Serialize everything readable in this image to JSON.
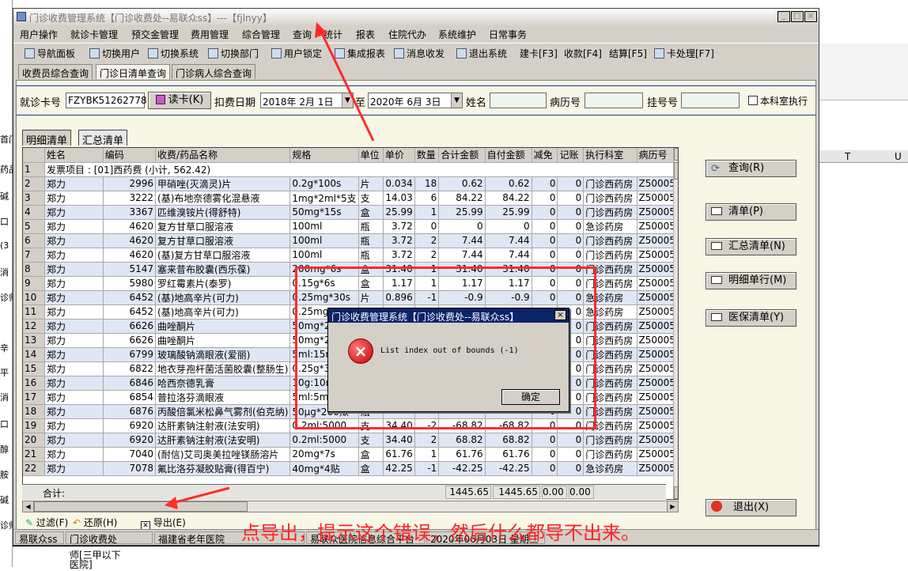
{
  "window": {
    "title": "门诊收费管理系统【门诊收费处--易联众ss】---【fjlnyy】",
    "controls": [
      "_",
      "□",
      "×"
    ]
  },
  "menu": [
    "用户操作",
    "就诊卡管理",
    "预交金管理",
    "费用管理",
    "综合管理",
    "查询",
    "统计",
    "报表",
    "住院代办",
    "系统维护",
    "日常事务"
  ],
  "toolbar": [
    "导航面板",
    "切换用户",
    "切换系统",
    "切换部门",
    "用户锁定",
    "集成报表",
    "消息收发",
    "退出系统",
    "建卡[F3]",
    "收款[F4]",
    "结算[F5]",
    "卡处理[F7]"
  ],
  "tabs": [
    "收费员综合查询",
    "门诊日清单查询",
    "门诊病人综合查询"
  ],
  "search": {
    "card_label": "就诊卡号",
    "card_value": "FZYBK51262778",
    "read_button": "读卡(K)",
    "date_label": "扣费日期",
    "date_from": "2018年 2月 1日",
    "to_label": "至",
    "date_to": "2020年 6月 3日",
    "name_label": "姓名",
    "record_label": "病历号",
    "reg_label": "挂号号",
    "dept_only_label": "本科室执行"
  },
  "subtabs": [
    "明细清单",
    "汇总清单"
  ],
  "grid": {
    "headers": [
      "姓名",
      "编码",
      "收费/药品名称",
      "规格",
      "单位",
      "单价",
      "数量",
      "合计金额",
      "自付金额",
      "减免",
      "记账",
      "执行科室",
      "病历号"
    ],
    "group_row": {
      "num": "1",
      "text": "发票项目 : [01]西药费 (小计, 562.42)"
    },
    "rows": [
      [
        "2",
        "郑力",
        "2996",
        "甲硝唑(灭滴灵)片",
        "0.2g*100s",
        "片",
        "0.034",
        "18",
        "0.62",
        "0.62",
        "0",
        "0",
        "门诊西药房",
        "Z50005"
      ],
      [
        "3",
        "郑力",
        "3222",
        "(基)布地奈德雾化混悬液",
        "1mg*2ml*5支",
        "支",
        "14.03",
        "6",
        "84.22",
        "84.22",
        "0",
        "0",
        "门诊西药房",
        "Z50005"
      ],
      [
        "4",
        "郑力",
        "3367",
        "匹维溴铵片(得舒特)",
        "50mg*15s",
        "盒",
        "25.99",
        "1",
        "25.99",
        "25.99",
        "0",
        "0",
        "门诊西药房",
        "Z50005"
      ],
      [
        "5",
        "郑力",
        "4620",
        "复方甘草口服溶液",
        "100ml",
        "瓶",
        "3.72",
        "0",
        "0",
        "0",
        "0",
        "0",
        "急诊药房",
        "Z50005"
      ],
      [
        "6",
        "郑力",
        "4620",
        "复方甘草口服溶液",
        "100ml",
        "瓶",
        "3.72",
        "2",
        "7.44",
        "7.44",
        "0",
        "0",
        "门诊西药房",
        "Z50005"
      ],
      [
        "7",
        "郑力",
        "4620",
        "(基)复方甘草口服溶液",
        "100ml",
        "瓶",
        "3.72",
        "2",
        "7.44",
        "7.44",
        "0",
        "0",
        "门诊西药房",
        "Z50005"
      ],
      [
        "8",
        "郑力",
        "5147",
        "塞来昔布胶囊(西乐葆)",
        "200mg*6s",
        "盒",
        "31.40",
        "1",
        "31.40",
        "31.40",
        "0",
        "0",
        "门诊西药房",
        "Z50005"
      ],
      [
        "9",
        "郑力",
        "5980",
        "罗红霉素片(泰罗)",
        "0.15g*6s",
        "盒",
        "1.17",
        "1",
        "1.17",
        "1.17",
        "0",
        "0",
        "门诊西药房",
        "Z50005"
      ],
      [
        "10",
        "郑力",
        "6452",
        "(基)地高辛片(可力)",
        "0.25mg*30s",
        "片",
        "0.896",
        "-1",
        "-0.9",
        "-0.9",
        "0",
        "0",
        "急诊药房",
        "Z50005"
      ],
      [
        "11",
        "郑力",
        "6452",
        "(基)地高辛片(可力)",
        "0.25mg*30s",
        "片",
        "0.896",
        "1",
        "0.9",
        "0.9",
        "0",
        "0",
        "急诊药房",
        "Z50005"
      ],
      [
        "12",
        "郑力",
        "6626",
        "曲唑酮片",
        "50mg*20s",
        "盒",
        "",
        "",
        "",
        "",
        "0",
        "0",
        "门诊西药房",
        "Z50005"
      ],
      [
        "13",
        "郑力",
        "6626",
        "曲唑酮片",
        "50mg*20s",
        "盒",
        "",
        "",
        "",
        "",
        "0",
        "0",
        "门诊西药房",
        "Z50005"
      ],
      [
        "14",
        "郑力",
        "6799",
        "玻璃酸钠滴眼液(爱丽)",
        "5ml:15mg",
        "支",
        "",
        "",
        "",
        "",
        "0",
        "0",
        "门诊西药房",
        "Z50005"
      ],
      [
        "15",
        "郑力",
        "6822",
        "地衣芽孢杆菌活菌胶囊(整肠生)",
        "0.25g*36s",
        "盒",
        "",
        "",
        "",
        "",
        "0",
        "0",
        "门诊西药房",
        "Z50005"
      ],
      [
        "16",
        "郑力",
        "6846",
        "哈西奈德乳膏",
        "10g:10mg",
        "支",
        "",
        "",
        "",
        "",
        "0",
        "0",
        "门诊西药房",
        "Z50005"
      ],
      [
        "17",
        "郑力",
        "6854",
        "普拉洛芬滴眼液",
        "5ml:5mg",
        "支",
        "",
        "",
        "",
        "",
        "0",
        "0",
        "门诊西药房",
        "Z50005"
      ],
      [
        "18",
        "郑力",
        "6876",
        "丙酸倍氯米松鼻气雾剂(伯克纳)",
        "50μg*200揿",
        "瓶",
        "",
        "",
        "",
        "",
        "0",
        "0",
        "门诊西药房",
        "Z50005"
      ],
      [
        "19",
        "郑力",
        "6920",
        "达肝素钠注射液(法安明)",
        "0.2ml:5000",
        "支",
        "34.40",
        "-2",
        "-68.82",
        "-68.82",
        "0",
        "0",
        "门诊西药房",
        "Z50005"
      ],
      [
        "20",
        "郑力",
        "6920",
        "达肝素钠注射液(法安明)",
        "0.2ml:5000",
        "支",
        "34.40",
        "2",
        "68.82",
        "68.82",
        "0",
        "0",
        "门诊西药房",
        "Z50005"
      ],
      [
        "21",
        "郑力",
        "7040",
        "(耐信)艾司奥美拉唑镁肠溶片",
        "20mg*7s",
        "盒",
        "61.76",
        "1",
        "61.76",
        "61.76",
        "0",
        "0",
        "门诊西药房",
        "Z50005"
      ],
      [
        "22",
        "郑力",
        "7078",
        "氟比洛芬凝胶贴膏(得百宁)",
        "40mg*4贴",
        "盒",
        "42.25",
        "-1",
        "-42.25",
        "-42.25",
        "0",
        "0",
        "急诊药房",
        "Z50005"
      ]
    ],
    "sum_label": "合计:",
    "sum_total": "1445.65",
    "sum_self": "1445.65",
    "sum_reduce": "0.00",
    "sum_account": "0.00"
  },
  "side_buttons": [
    "查询(R)",
    "清单(P)",
    "汇总清单(N)",
    "明细单行(M)",
    "医保清单(Y)",
    "退出(X)"
  ],
  "bottom_actions": [
    "过滤(F)",
    "还原(H)",
    "导出(E)"
  ],
  "statusbar": [
    "易联众ss",
    "门诊收费处",
    "福建省老年医院",
    "易联众医院信息综合平台",
    "2020年06月03日 星期三"
  ],
  "dialog": {
    "title": "门诊收费管理系统【门诊收费处--易联众ss】",
    "message": "List index out of bounds (-1)",
    "ok": "确定",
    "close": "×"
  },
  "annotation": "点导出，提示这个错误，然后什么都导不出来。",
  "background": {
    "left_fragments": [
      "首门",
      "药品",
      "碱",
      "口",
      "(3",
      "消",
      "诊师",
      "辛",
      "平",
      "消",
      "口",
      "醇",
      "胺",
      "碱",
      "诊师"
    ],
    "right_cols": [
      "T",
      "U"
    ],
    "bottom_text": [
      "师[三甲以下",
      "医院]"
    ]
  },
  "colors": {
    "annotation_red": "#ff2222",
    "dialog_title_bg": "#0a246a",
    "row_alt": "#dfe6f4",
    "panel_bg": "#f8f7e6"
  }
}
